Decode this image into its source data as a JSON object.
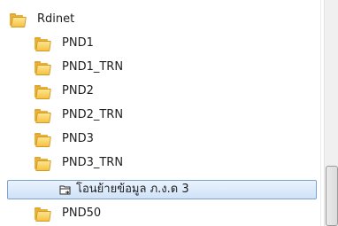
{
  "tree": {
    "root": {
      "label": "Rdinet",
      "icon": "folder-icon"
    },
    "children": [
      {
        "label": "PND1",
        "icon": "folder-icon"
      },
      {
        "label": "PND1_TRN",
        "icon": "folder-icon"
      },
      {
        "label": "PND2",
        "icon": "folder-icon"
      },
      {
        "label": "PND2_TRN",
        "icon": "folder-icon"
      },
      {
        "label": "PND3",
        "icon": "folder-icon"
      },
      {
        "label": "PND3_TRN",
        "icon": "folder-icon"
      }
    ],
    "selected_item": {
      "label": "โอนย้ายข้อมูล ภ.ง.ด 3",
      "icon": "shortcut-icon"
    },
    "after": [
      {
        "label": "PND50",
        "icon": "folder-icon"
      }
    ]
  },
  "colors": {
    "folder": "#f5c243",
    "selection_border": "#7da2ce",
    "selection_fill": "#dceafb"
  }
}
